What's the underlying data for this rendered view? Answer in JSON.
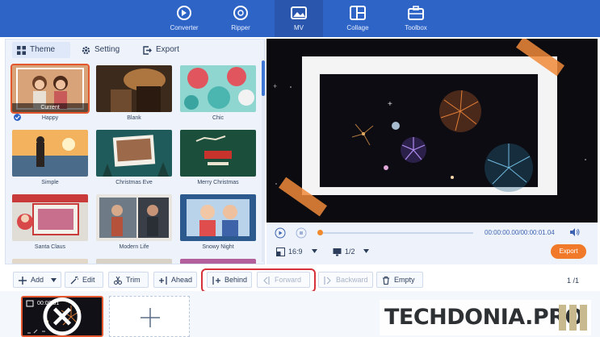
{
  "nav": {
    "items": [
      {
        "label": "Converter",
        "icon": "converter-icon"
      },
      {
        "label": "Ripper",
        "icon": "disc-icon"
      },
      {
        "label": "MV",
        "icon": "mv-image-icon",
        "active": true
      },
      {
        "label": "Collage",
        "icon": "collage-icon"
      },
      {
        "label": "Toolbox",
        "icon": "toolbox-icon"
      }
    ]
  },
  "tabs": [
    {
      "label": "Theme",
      "icon": "grid-icon",
      "active": true
    },
    {
      "label": "Setting",
      "icon": "gear-icon"
    },
    {
      "label": "Export",
      "icon": "export-icon"
    }
  ],
  "themes": [
    {
      "name": "Happy",
      "selected": true,
      "badge": "Current"
    },
    {
      "name": "Blank"
    },
    {
      "name": "Chic"
    },
    {
      "name": "Simple"
    },
    {
      "name": "Christmas Eve"
    },
    {
      "name": "Merry Christmas"
    },
    {
      "name": "Santa Claus"
    },
    {
      "name": "Modern Life"
    },
    {
      "name": "Snowy Night"
    }
  ],
  "player": {
    "time": "00:00:00.00/00:00:01.04",
    "progress": 0,
    "ratio": "16:9",
    "page": "1/2",
    "export_label": "Export"
  },
  "toolbar": {
    "buttons": [
      {
        "label": "Add",
        "icon": "plus-icon",
        "has_dropdown": true,
        "enabled": true
      },
      {
        "label": "Edit",
        "icon": "magic-wand-icon",
        "enabled": true
      },
      {
        "label": "Trim",
        "icon": "scissors-icon",
        "enabled": true
      },
      {
        "label": "Ahead",
        "icon": "insert-ahead-icon",
        "enabled": true
      },
      {
        "label": "Behind",
        "icon": "insert-behind-icon",
        "enabled": true
      },
      {
        "label": "Forward",
        "icon": "move-forward-icon",
        "enabled": false
      },
      {
        "label": "Backward",
        "icon": "move-backward-icon",
        "enabled": false
      },
      {
        "label": "Empty",
        "icon": "trash-icon",
        "enabled": true
      }
    ],
    "page_indicator": "1 /1"
  },
  "timeline": {
    "clip_time": "00:00:01"
  },
  "watermark": {
    "text": "TECHDONIA.PRO"
  },
  "colors": {
    "nav_bg": "#2f64c7",
    "accent": "#f07a2a",
    "highlight": "#d6323b"
  }
}
